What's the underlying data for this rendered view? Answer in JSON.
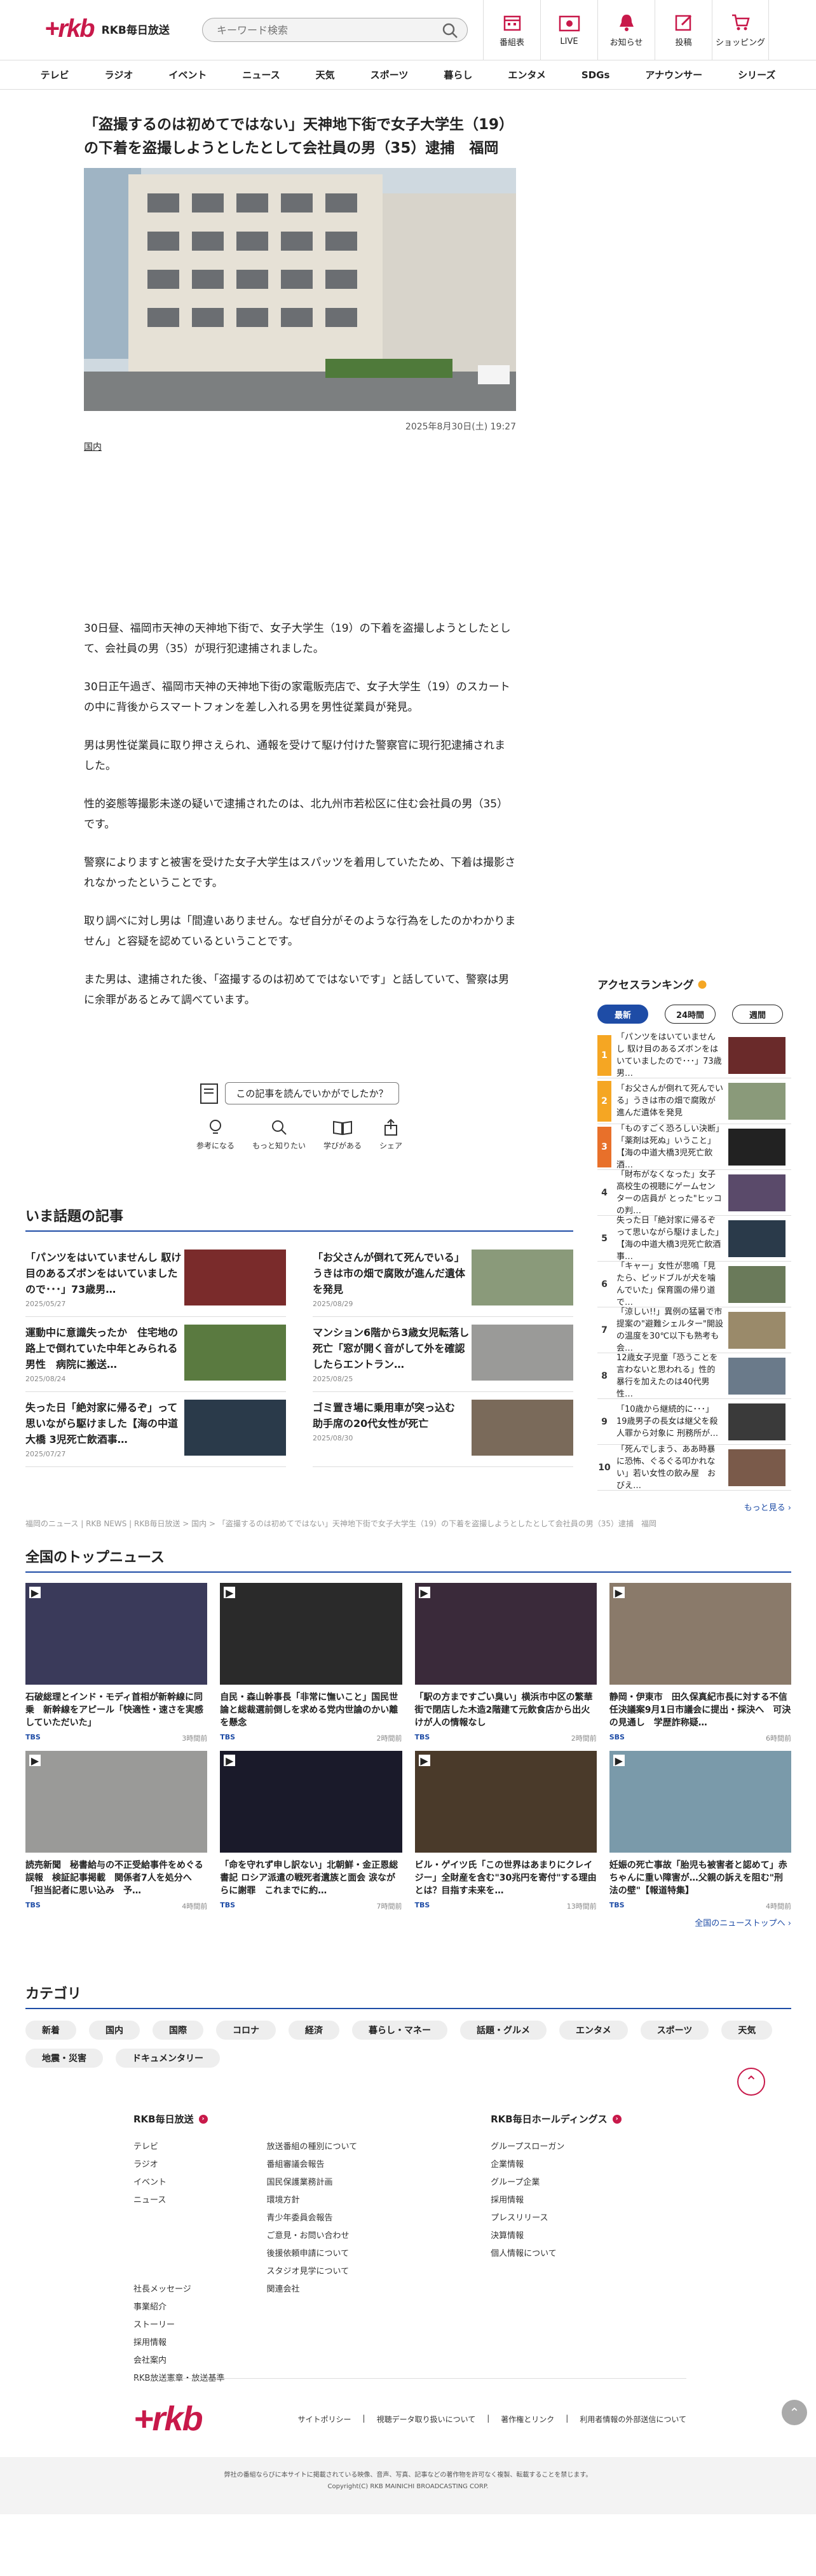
{
  "header": {
    "logo_text": "RKB毎日放送",
    "search_placeholder": "キーワード検索",
    "icons": [
      {
        "label": "番組表",
        "icon": "calendar-icon"
      },
      {
        "label": "LIVE",
        "icon": "live-icon"
      },
      {
        "label": "お知らせ",
        "icon": "bell-icon"
      },
      {
        "label": "投稿",
        "icon": "post-icon"
      },
      {
        "label": "ショッピング",
        "icon": "cart-icon"
      }
    ]
  },
  "nav": [
    "テレビ",
    "ラジオ",
    "イベント",
    "ニュース",
    "天気",
    "スポーツ",
    "暮らし",
    "エンタメ",
    "SDGs",
    "アナウンサー",
    "シリーズ"
  ],
  "article": {
    "title": "「盗撮するのは初めてではない」天神地下街で女子大学生（19）の下着を盗撮しようとしたとして会社員の男（35）逮捕　福岡",
    "date": "2025年8月30日(土) 19:27",
    "category": "国内",
    "paragraphs": [
      "30日昼、福岡市天神の天神地下街で、女子大学生（19）の下着を盗撮しようとしたとして、会社員の男（35）が現行犯逮捕されました。",
      "30日正午過ぎ、福岡市天神の天神地下街の家電販売店で、女子大学生（19）のスカートの中に背後からスマートフォンを差し入れる男を男性従業員が発見。",
      "男は男性従業員に取り押さえられ、通報を受けて駆け付けた警察官に現行犯逮捕されました。",
      "性的姿態等撮影未遂の疑いで逮捕されたのは、北九州市若松区に住む会社員の男（35）です。",
      "警察によりますと被害を受けた女子大学生はスパッツを着用していたため、下着は撮影されなかったということです。",
      "取り調べに対し男は「間違いありません。なぜ自分がそのような行為をしたのかわかりません」と容疑を認めているということです。",
      "また男は、逮捕された後、「盗撮するのは初めてではないです」と話していて、警察は男に余罪があるとみて調べています。"
    ]
  },
  "feedback": {
    "question": "この記事を読んでいかがでしたか？",
    "buttons": [
      "参考になる",
      "もっと知りたい",
      "学びがある",
      "シェア"
    ]
  },
  "topics": {
    "title": "いま話題の記事",
    "items": [
      {
        "text": "「パンツをはいていませんし 馭け目のあるズボンをはいていましたので･･･」73歳男…",
        "date": "2025/05/27",
        "color": "#7a2b2b"
      },
      {
        "text": "「お父さんが倒れて死んでいる」うきは市の畑で腐敗が進んだ遺体を発見",
        "date": "2025/08/29",
        "color": "#8a9a7a"
      },
      {
        "text": "運動中に意識失ったか　住宅地の路上で倒れていた中年とみられる男性　病院に搬送…",
        "date": "2025/08/24",
        "color": "#5a7a40"
      },
      {
        "text": "マンション6階から3歳女児転落し死亡「窓が開く音がして外を確認したらエントラン…",
        "date": "2025/08/25",
        "color": "#9a9a98"
      },
      {
        "text": "失った日「絶対家に帰るぞ」って思いながら駆けました【海の中道大橋 3児死亡飲酒事…",
        "date": "2025/07/27",
        "color": "#2a3a4a"
      },
      {
        "text": "ゴミ置き場に乗用車が突っ込む　助手席の20代女性が死亡",
        "date": "2025/08/30",
        "color": "#7a6a5a"
      }
    ]
  },
  "breadcrumb": "福岡のニュース | RKB NEWS | RKB毎日放送 > 国内 > 「盗撮するのは初めてではない」天神地下街で女子大学生（19）の下着を盗撮しようとしたとして会社員の男（35）逮捕　福岡",
  "ranking": {
    "title": "アクセスランキング",
    "tabs": [
      "最新",
      "24時間",
      "週間"
    ],
    "items": [
      {
        "num": "1",
        "text": "「パンツをはいていませんし 馭け目のあるズボンをはいていましたので･･･」73歳男…",
        "color": "#f5a623",
        "thumb": "#6a2a2a"
      },
      {
        "num": "2",
        "text": "「お父さんが倒れて死んでいる」うきは市の畑で腐敗が進んだ遺体を発見",
        "color": "#f5a623",
        "thumb": "#8a9a7a"
      },
      {
        "num": "3",
        "text": "「ものすごく恐ろしい決断」「薬剤は死ぬ」いうこと」【海の中道大橋3児死亡飲酒…",
        "color": "#e8702a",
        "thumb": "#222"
      },
      {
        "num": "4",
        "text": "「財布がなくなった」女子高校生の視聴にゲームセンターの店員が とった\"ヒッコの判…",
        "color": "#888",
        "thumb": "#5a4a6a"
      },
      {
        "num": "5",
        "text": "失った日「絶対家に帰るぞって思いながら駆けました」【海の中道大橋3児死亡飲酒事…",
        "color": "#888",
        "thumb": "#2a3a4a"
      },
      {
        "num": "6",
        "text": "「キャー」女性が悲鳴「見たら、ピッドブルが犬を噛んでいた」保育園の帰り道で…",
        "color": "#888",
        "thumb": "#6a7a5a"
      },
      {
        "num": "7",
        "text": "「涼しい!!」異例の猛暑で市提案の\"避難シェルター\"開設の温度を30℃以下も熟考も　会…",
        "color": "#888",
        "thumb": "#9a8a6a"
      },
      {
        "num": "8",
        "text": "12歳女子児童「恐うことを言わないと思われる」性的暴行を加えたのは40代男性…",
        "color": "#888",
        "thumb": "#6a7a8a"
      },
      {
        "num": "9",
        "text": "「10歳から継続的に･･･」19歳男子の長女は継父を殺人罪から対象に 刑務所が…",
        "color": "#888",
        "thumb": "#3a3a3a"
      },
      {
        "num": "10",
        "text": "「死んでしまう、ああ時暴に恐怖、ぐるぐる叩かれない」若い女性の飲み屋　おびえ…",
        "color": "#888",
        "thumb": "#7a5a4a"
      }
    ],
    "more": "もっと見る"
  },
  "national": {
    "title": "全国のトップニュース",
    "items": [
      {
        "text": "石破総理とインド・モディ首相が新幹線に同乗　新幹線をアピール「快適性・速さを実感していただいた」",
        "source": "TBS",
        "time": "3時間前",
        "color": "#3a3a5a"
      },
      {
        "text": "自民・森山幹事長「非常に憮いこと」国民世論と総裁選前倒しを求める党内世論のかい離を懸念",
        "source": "TBS",
        "time": "2時間前",
        "color": "#2a2a2a"
      },
      {
        "text": "「駅の方まですごい臭い」横浜市中区の繁華街で閉店した木造2階建て元飲食店から出火　けが人の情報なし",
        "source": "TBS",
        "time": "2時間前",
        "color": "#3a2a3a"
      },
      {
        "text": "静岡・伊東市　田久保真紀市長に対する不信任決議案9月1日市議会に提出・採決へ　可決の見通し　学歴詐称疑…",
        "source": "SBS",
        "time": "6時間前",
        "color": "#8a7a6a"
      },
      {
        "text": "読売新聞　秘書給与の不正受給事件をめぐる誤報　検証記事掲載　関係者7人を処分へ「担当記者に思い込み　予…",
        "source": "TBS",
        "time": "4時間前",
        "color": "#9a9a98"
      },
      {
        "text": "「命を守れず申し訳ない」北朝鮮・金正恩総書記 ロシア派遣の戦死者遺族と面会 涙ながらに謝罪　これまでに約…",
        "source": "TBS",
        "time": "7時間前",
        "color": "#1a1a2a"
      },
      {
        "text": "ビル・ゲイツ氏「この世界はあまりにクレイジー」全財産を含む\"30兆円を寄付\"する理由とは？目指す未来を…",
        "source": "TBS",
        "time": "13時間前",
        "color": "#4a3a2a"
      },
      {
        "text": "妊娠の死亡事故「胎児も被害者と認めて」赤ちゃんに重い障害が…父親の訴えを阻む\"刑法の壁\"【報道特集】",
        "source": "TBS",
        "time": "4時間前",
        "color": "#7a9aaa"
      }
    ],
    "more": "全国のニューストップへ"
  },
  "category": {
    "title": "カテゴリ",
    "chips": [
      "新着",
      "国内",
      "国際",
      "コロナ",
      "経済",
      "暮らし・マネー",
      "話題・グルメ",
      "エンタメ",
      "スポーツ",
      "天気",
      "地震・災害",
      "ドキュメンタリー"
    ]
  },
  "footer": {
    "col1_title": "RKB毎日放送",
    "col1_a": [
      "テレビ",
      "ラジオ",
      "イベント",
      "ニュース",
      "",
      "",
      "",
      "",
      "社長メッセージ",
      "事業紹介",
      "ストーリー",
      "採用情報",
      "会社案内",
      "RKB放送憲章・放送基準"
    ],
    "col1_b": [
      "放送番組の種別について",
      "番組審議会報告",
      "国民保護業務計画",
      "環境方針",
      "青少年委員会報告",
      "ご意見・お問い合わせ",
      "後援依頼申請について",
      "スタジオ見学について",
      "関連会社"
    ],
    "col2_title": "RKB毎日ホールディングス",
    "col2": [
      "グループスローガン",
      "企業情報",
      "グループ企業",
      "採用情報",
      "プレスリリース",
      "決算情報",
      "個人情報について"
    ],
    "bottom_links": [
      "サイトポリシー",
      "視聴データ取り扱いについて",
      "著作権とリンク",
      "利用者情報の外部送信について"
    ],
    "copy1": "弊社の番組ならびに本サイトに掲載されている映像、音声、写真、記事などの著作物を許可なく複製、転載することを禁じます。",
    "copy2": "Copyright(C) RKB MAINICHI BROADCASTING CORP."
  }
}
